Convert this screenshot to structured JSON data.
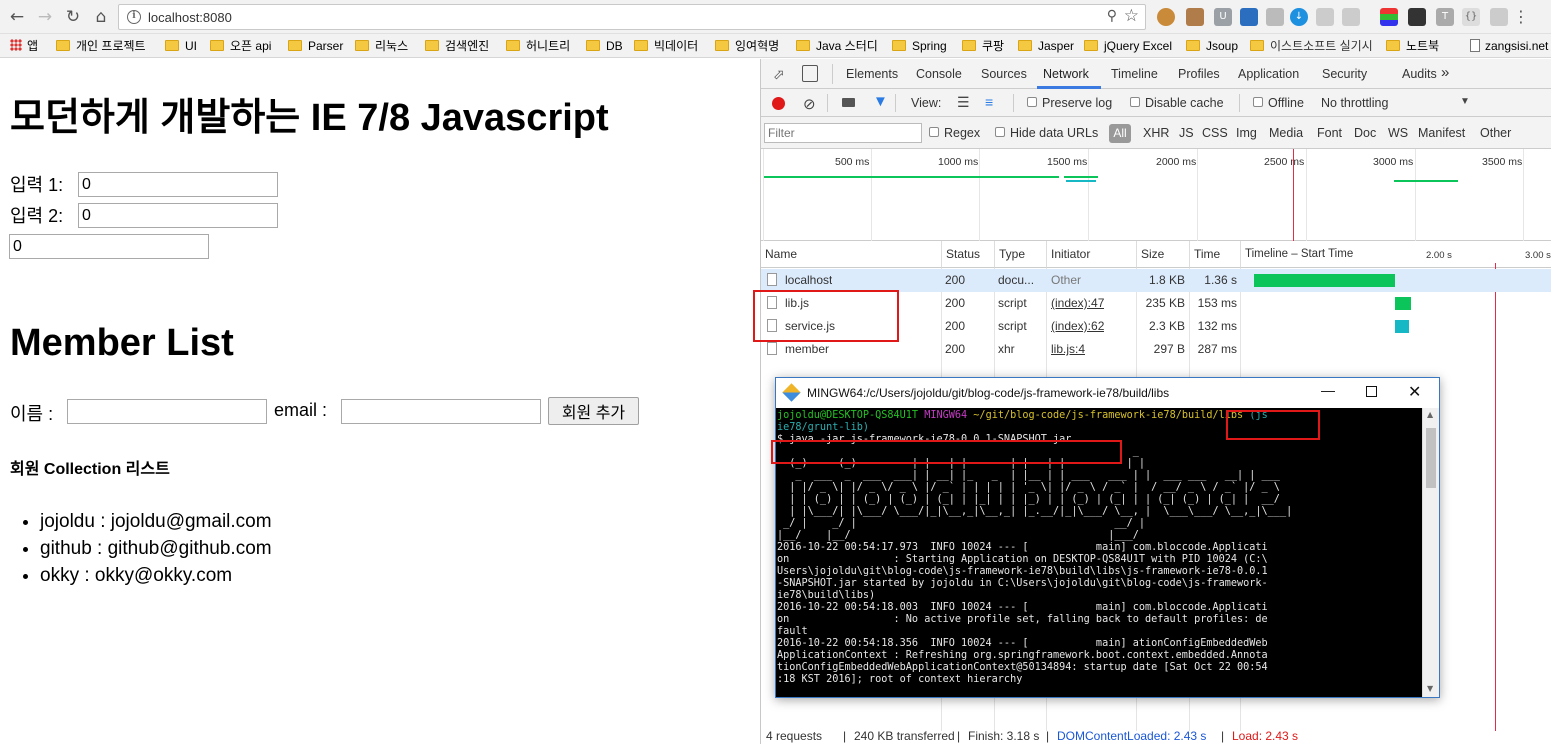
{
  "browser": {
    "url": "localhost:8080",
    "bookmarks": [
      {
        "label": "앱",
        "kind": "apps"
      },
      {
        "label": "개인 프로젝트",
        "kind": "folder"
      },
      {
        "label": "UI",
        "kind": "folder"
      },
      {
        "label": "오픈 api",
        "kind": "folder"
      },
      {
        "label": "Parser",
        "kind": "folder"
      },
      {
        "label": "리눅스",
        "kind": "folder"
      },
      {
        "label": "검색엔진",
        "kind": "folder"
      },
      {
        "label": "허니트리",
        "kind": "folder"
      },
      {
        "label": "DB",
        "kind": "folder"
      },
      {
        "label": "빅데이터",
        "kind": "folder"
      },
      {
        "label": "잉여혁명",
        "kind": "folder"
      },
      {
        "label": "Java 스터디",
        "kind": "folder"
      },
      {
        "label": "Spring",
        "kind": "folder"
      },
      {
        "label": "쿠팡",
        "kind": "folder"
      },
      {
        "label": "Jasper",
        "kind": "folder"
      },
      {
        "label": "jQuery Excel",
        "kind": "folder"
      },
      {
        "label": "Jsoup",
        "kind": "folder"
      },
      {
        "label": "이스트소프트 실기시",
        "kind": "folder"
      },
      {
        "label": "노트북",
        "kind": "folder"
      },
      {
        "label": "zangsisi.net",
        "kind": "page"
      }
    ]
  },
  "page": {
    "title": "모던하게 개발하는 IE 7/8 Javascript",
    "input1_label": "입력 1:",
    "input1_value": "0",
    "input2_label": "입력 2:",
    "input2_value": "0",
    "result_value": "0",
    "member_title": "Member List",
    "name_label": "이름 :",
    "email_label": "email :",
    "add_button": "회원 추가",
    "collection_title": "회원 Collection 리스트",
    "members": [
      "jojoldu : jojoldu@gmail.com",
      "github : github@github.com",
      "okky : okky@okky.com"
    ]
  },
  "devtools": {
    "tabs": [
      "Elements",
      "Console",
      "Sources",
      "Network",
      "Timeline",
      "Profiles",
      "Application",
      "Security",
      "Audits"
    ],
    "active_tab": "Network",
    "view_label": "View:",
    "preserve_log": "Preserve log",
    "disable_cache": "Disable cache",
    "offline": "Offline",
    "throttling": "No throttling",
    "filter_placeholder": "Filter",
    "regex": "Regex",
    "hide_data_urls": "Hide data URLs",
    "type_filters": [
      "All",
      "XHR",
      "JS",
      "CSS",
      "Img",
      "Media",
      "Font",
      "Doc",
      "WS",
      "Manifest",
      "Other"
    ],
    "overview_ticks": [
      "500 ms",
      "1000 ms",
      "1500 ms",
      "2000 ms",
      "2500 ms",
      "3000 ms",
      "3500 ms"
    ],
    "columns": [
      "Name",
      "Status",
      "Type",
      "Initiator",
      "Size",
      "Time",
      "Timeline – Start Time"
    ],
    "waterfall_ticks": [
      "2.00 s",
      "3.00 s"
    ],
    "requests": [
      {
        "name": "localhost",
        "status": "200",
        "type": "docu...",
        "initiator": "Other",
        "size": "1.8 KB",
        "time": "1.36 s",
        "bar_start": 0.0,
        "bar_end": 1.36
      },
      {
        "name": "lib.js",
        "status": "200",
        "type": "script",
        "initiator": "(index):47",
        "size": "235 KB",
        "time": "153 ms",
        "bar_start": 1.36,
        "bar_end": 1.51
      },
      {
        "name": "service.js",
        "status": "200",
        "type": "script",
        "initiator": "(index):62",
        "size": "2.3 KB",
        "time": "132 ms",
        "bar_start": 1.36,
        "bar_end": 1.49
      },
      {
        "name": "member",
        "status": "200",
        "type": "xhr",
        "initiator": "lib.js:4",
        "size": "297 B",
        "time": "287 ms",
        "bar_start": 0,
        "bar_end": 0
      }
    ],
    "status_bar": {
      "requests": "4 requests",
      "transferred": "240 KB transferred",
      "finish": "Finish: 3.18 s",
      "dom_loaded": "DOMContentLoaded: 2.43 s",
      "load": "Load: 2.43 s"
    }
  },
  "terminal": {
    "title": "MINGW64:/c/Users/jojoldu/git/blog-code/js-framework-ie78/build/libs",
    "prompt_user": "jojoldu@DESKTOP-QS84U1T",
    "prompt_shell": "MINGW64",
    "prompt_path": "~/git/blog-code/js-framework-ie78/build/libs",
    "prompt_branch": "(js",
    "prompt_branch_cont": "ie78/grunt-lib)",
    "command": "$ java -jar js-framework-ie78-0.0.1-SNAPSHOT.jar",
    "banner": [
      "                                                          _",
      "  (_)     (_)         | |   | |       | |   | |          | |",
      "   _  ___  _  ___  ___| | __| |_   _  | |__ | | ___   ___ | |  ___ ___   __| | ___",
      "  | |/ _ \\| |/ _ \\/ _ \\ |/ _` | | | | | '_ \\| |/ _ \\ / _` |  / __/ _ \\ / _` |/ _ \\",
      "  | | (_) | | (_) | (_) | (_| | |_| | | |_) | | (_) | (_| | | (_| (_) | (_| |  __/",
      "  | |\\___/| |\\___/ \\___/|_|\\__,_|\\__,_| |_.__/|_|\\___/ \\__, |  \\___\\___/ \\__,_|\\___|",
      " _/ |    _/ |                                          __/ |",
      "|__/    |__/                                          |___/"
    ],
    "log": [
      "2016-10-22 00:54:17.973  INFO 10024 --- [           main] com.bloccode.Applicati",
      "on                 : Starting Application on DESKTOP-QS84U1T with PID 10024 (C:\\",
      "Users\\jojoldu\\git\\blog-code\\js-framework-ie78\\build\\libs\\js-framework-ie78-0.0.1",
      "-SNAPSHOT.jar started by jojoldu in C:\\Users\\jojoldu\\git\\blog-code\\js-framework-",
      "ie78\\build\\libs)",
      "2016-10-22 00:54:18.003  INFO 10024 --- [           main] com.bloccode.Applicati",
      "on                 : No active profile set, falling back to default profiles: de",
      "fault",
      "2016-10-22 00:54:18.356  INFO 10024 --- [           main] ationConfigEmbeddedWeb",
      "ApplicationContext : Refreshing org.springframework.boot.context.embedded.Annota",
      "tionConfigEmbeddedWebApplicationContext@50134894: startup date [Sat Oct 22 00:54",
      ":18 KST 2016]; root of context hierarchy"
    ]
  },
  "colors": {
    "highlight": "#e01818",
    "bar_green": "#0bc45a",
    "bar_teal": "#15b8c4",
    "link_blue": "#1a57d6"
  }
}
